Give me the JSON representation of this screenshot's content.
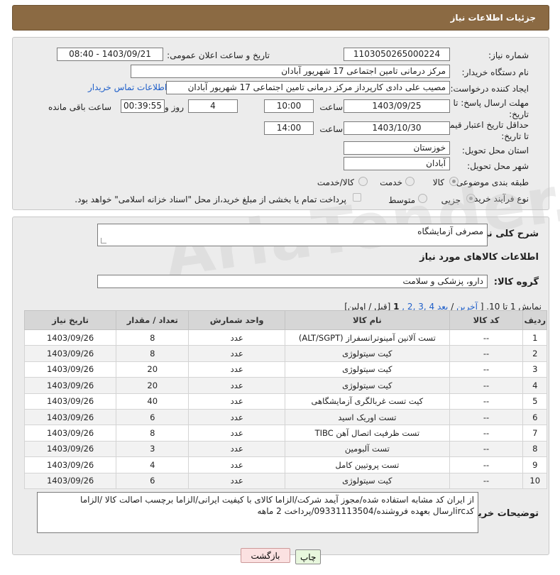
{
  "header": {
    "title": "جزئیات اطلاعات نیاز"
  },
  "form": {
    "need_number_label": "شماره نیاز:",
    "need_number": "1103050265000224",
    "announce_label": "تاریخ و ساعت اعلان عمومی:",
    "announce_value": "1403/09/21 - 08:40",
    "buyer_org_label": "نام دستگاه خریدار:",
    "buyer_org": "مرکز درمانی تامین اجتماعی 17 شهریور آبادان",
    "creator_label": "ایجاد کننده درخواست:",
    "creator": "مصیب علی دادی کارپرداز مرکز درمانی تامین اجتماعی 17 شهریور آبادان",
    "contact_link": "اطلاعات تماس خریدار",
    "deadline_label": "مهلت ارسال پاسخ: تا تاریخ:",
    "deadline_date": "1403/09/25",
    "time_label": "ساعت",
    "deadline_time": "10:00",
    "days_value": "4",
    "days_label": "روز و",
    "remaining_value": "00:39:55",
    "remaining_label": "ساعت باقی مانده",
    "validity_label": "حداقل تاریخ اعتبار قیمت: تا تاریخ:",
    "validity_date": "1403/10/30",
    "validity_time_label": "ساعت",
    "validity_time": "14:00",
    "province_label": "استان محل تحویل:",
    "province": "خوزستان",
    "city_label": "شهر محل تحویل:",
    "city": "آبادان",
    "category_label": "طبقه بندی موضوعی:",
    "category_options": [
      "کالا",
      "خدمت",
      "کالا/خدمت"
    ],
    "process_label": "نوع فرآیند خرید :",
    "process_options": [
      "جزیی",
      "متوسط"
    ],
    "payment_note": "پرداخت تمام یا بخشی از مبلغ خرید،از محل \"اسناد خزانه اسلامی\" خواهد بود."
  },
  "description": {
    "label": "شرح کلی نیاز:",
    "value": "مصرفی آزمایشگاه"
  },
  "goods": {
    "section_title": "اطلاعات کالاهای مورد نیاز",
    "group_label": "گروه کالا:",
    "group_value": "دارو، پزشکی و سلامت",
    "pager": {
      "showing": "نمایش 1 تا 10. [",
      "last": "آخرین",
      "next": "بعد",
      "pages": "4 ,3 ,2 ,",
      "current": "1",
      "tail": "[قبل / اولین]"
    }
  },
  "table": {
    "headers": [
      "ردیف",
      "کد کالا",
      "نام کالا",
      "واحد شمارش",
      "تعداد / مقدار",
      "تاریخ نیاز"
    ],
    "rows": [
      {
        "row": "1",
        "code": "--",
        "name": "تست آلانین آمینوترانسفراز (ALT/SGPT)",
        "unit": "عدد",
        "qty": "8",
        "date": "1403/09/26"
      },
      {
        "row": "2",
        "code": "--",
        "name": "کیت سیتولوژی",
        "unit": "عدد",
        "qty": "8",
        "date": "1403/09/26"
      },
      {
        "row": "3",
        "code": "--",
        "name": "کیت سیتولوژی",
        "unit": "عدد",
        "qty": "20",
        "date": "1403/09/26"
      },
      {
        "row": "4",
        "code": "--",
        "name": "کیت سیتولوژی",
        "unit": "عدد",
        "qty": "20",
        "date": "1403/09/26"
      },
      {
        "row": "5",
        "code": "--",
        "name": "کیت تست غربالگری آزمایشگاهی",
        "unit": "عدد",
        "qty": "40",
        "date": "1403/09/26"
      },
      {
        "row": "6",
        "code": "--",
        "name": "تست اوریک اسید",
        "unit": "عدد",
        "qty": "6",
        "date": "1403/09/26"
      },
      {
        "row": "7",
        "code": "--",
        "name": "تست ظرفیت اتصال آهن TIBC",
        "unit": "عدد",
        "qty": "8",
        "date": "1403/09/26"
      },
      {
        "row": "8",
        "code": "--",
        "name": "تست آلبومین",
        "unit": "عدد",
        "qty": "3",
        "date": "1403/09/26"
      },
      {
        "row": "9",
        "code": "--",
        "name": "تست پروتیین کامل",
        "unit": "عدد",
        "qty": "4",
        "date": "1403/09/26"
      },
      {
        "row": "10",
        "code": "--",
        "name": "کیت سیتولوژی",
        "unit": "عدد",
        "qty": "6",
        "date": "1403/09/26"
      }
    ]
  },
  "buyer_notes": {
    "label": "توضیحات خریدار:",
    "value": "از ایران کد مشابه استفاده شده/مجوز آیمد شرکت/الزاما کالای با کیفیت ایرانی/الزاما برچسب اصالت کالا /الزاما کدircارسال بعهده فروشنده/09331113504/پرداخت 2 ماهه"
  },
  "buttons": {
    "print": "چاپ",
    "back": "بازگشت"
  },
  "colors": {
    "title_bg": "#8b6a43",
    "link": "#1f5fc9",
    "print_btn": "#e8f7dd",
    "back_btn": "#fbe1e1"
  }
}
